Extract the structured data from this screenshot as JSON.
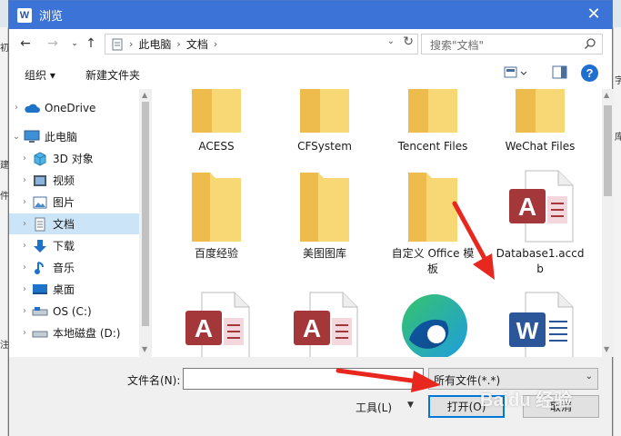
{
  "window": {
    "title": "浏览",
    "app_icon": "word-icon",
    "accent": "#3b74d6"
  },
  "address": {
    "crumbs": [
      "此电脑",
      "文档"
    ],
    "search_placeholder": "搜索\"文档\""
  },
  "toolbar": {
    "organize_label": "组织 ▾",
    "new_folder_label": "新建文件夹"
  },
  "nav_tree": [
    {
      "label": "OneDrive",
      "icon": "cloud-icon"
    },
    {
      "label": "此电脑",
      "icon": "pc-icon"
    },
    {
      "label": "3D 对象",
      "icon": "cube-icon"
    },
    {
      "label": "视频",
      "icon": "video-icon"
    },
    {
      "label": "图片",
      "icon": "picture-icon"
    },
    {
      "label": "文档",
      "icon": "document-icon",
      "selected": true
    },
    {
      "label": "下载",
      "icon": "download-icon"
    },
    {
      "label": "音乐",
      "icon": "music-icon"
    },
    {
      "label": "桌面",
      "icon": "desktop-icon"
    },
    {
      "label": "OS (C:)",
      "icon": "drive-icon"
    },
    {
      "label": "本地磁盘 (D:)",
      "icon": "drive-icon"
    }
  ],
  "files": [
    {
      "name": "ACESS",
      "type": "folder"
    },
    {
      "name": "CFSystem",
      "type": "folder"
    },
    {
      "name": "Tencent Files",
      "type": "folder"
    },
    {
      "name": "WeChat Files",
      "type": "folder"
    },
    {
      "name": "百度经验",
      "type": "folder"
    },
    {
      "name": "美图图库",
      "type": "folder"
    },
    {
      "name_line1": "自定义 Office 模",
      "name_line2": "板",
      "type": "folder"
    },
    {
      "name_line1": "Database1.accd",
      "name_line2": "b",
      "type": "access"
    },
    {
      "name": "",
      "type": "access"
    },
    {
      "name": "",
      "type": "access"
    },
    {
      "name": "",
      "type": "edge"
    },
    {
      "name": "",
      "type": "word"
    }
  ],
  "footer": {
    "filename_label": "文件名(N):",
    "filename_value": "",
    "filter_value": "所有文件(*.*)",
    "tools_label": "工具(L)",
    "open_label": "打开(O)",
    "cancel_label": "取消"
  },
  "background_app": {
    "left_chars": [
      "初",
      "建",
      "件",
      "注"
    ],
    "right_chars": [
      "字",
      "库"
    ]
  },
  "watermark": "Baidu 经验"
}
